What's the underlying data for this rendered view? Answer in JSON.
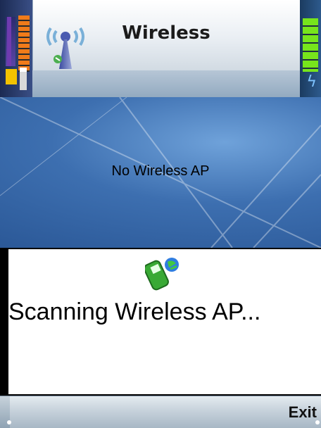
{
  "header": {
    "title": "Wireless"
  },
  "main": {
    "status_text": "No Wireless AP"
  },
  "dialog": {
    "message": "Scanning Wireless AP..."
  },
  "softkeys": {
    "right_label": "Exit"
  },
  "colors": {
    "body_blue": "#3d6fb0",
    "battery_green": "#77e51c",
    "signal_orange": "#f07b1a"
  },
  "icons": {
    "header_icon": "wireless-antenna-icon",
    "dialog_icon": "phone-globe-icon",
    "battery": "battery-level-icon",
    "signal": "signal-strength-icon",
    "charging": "charging-bolt-icon"
  }
}
